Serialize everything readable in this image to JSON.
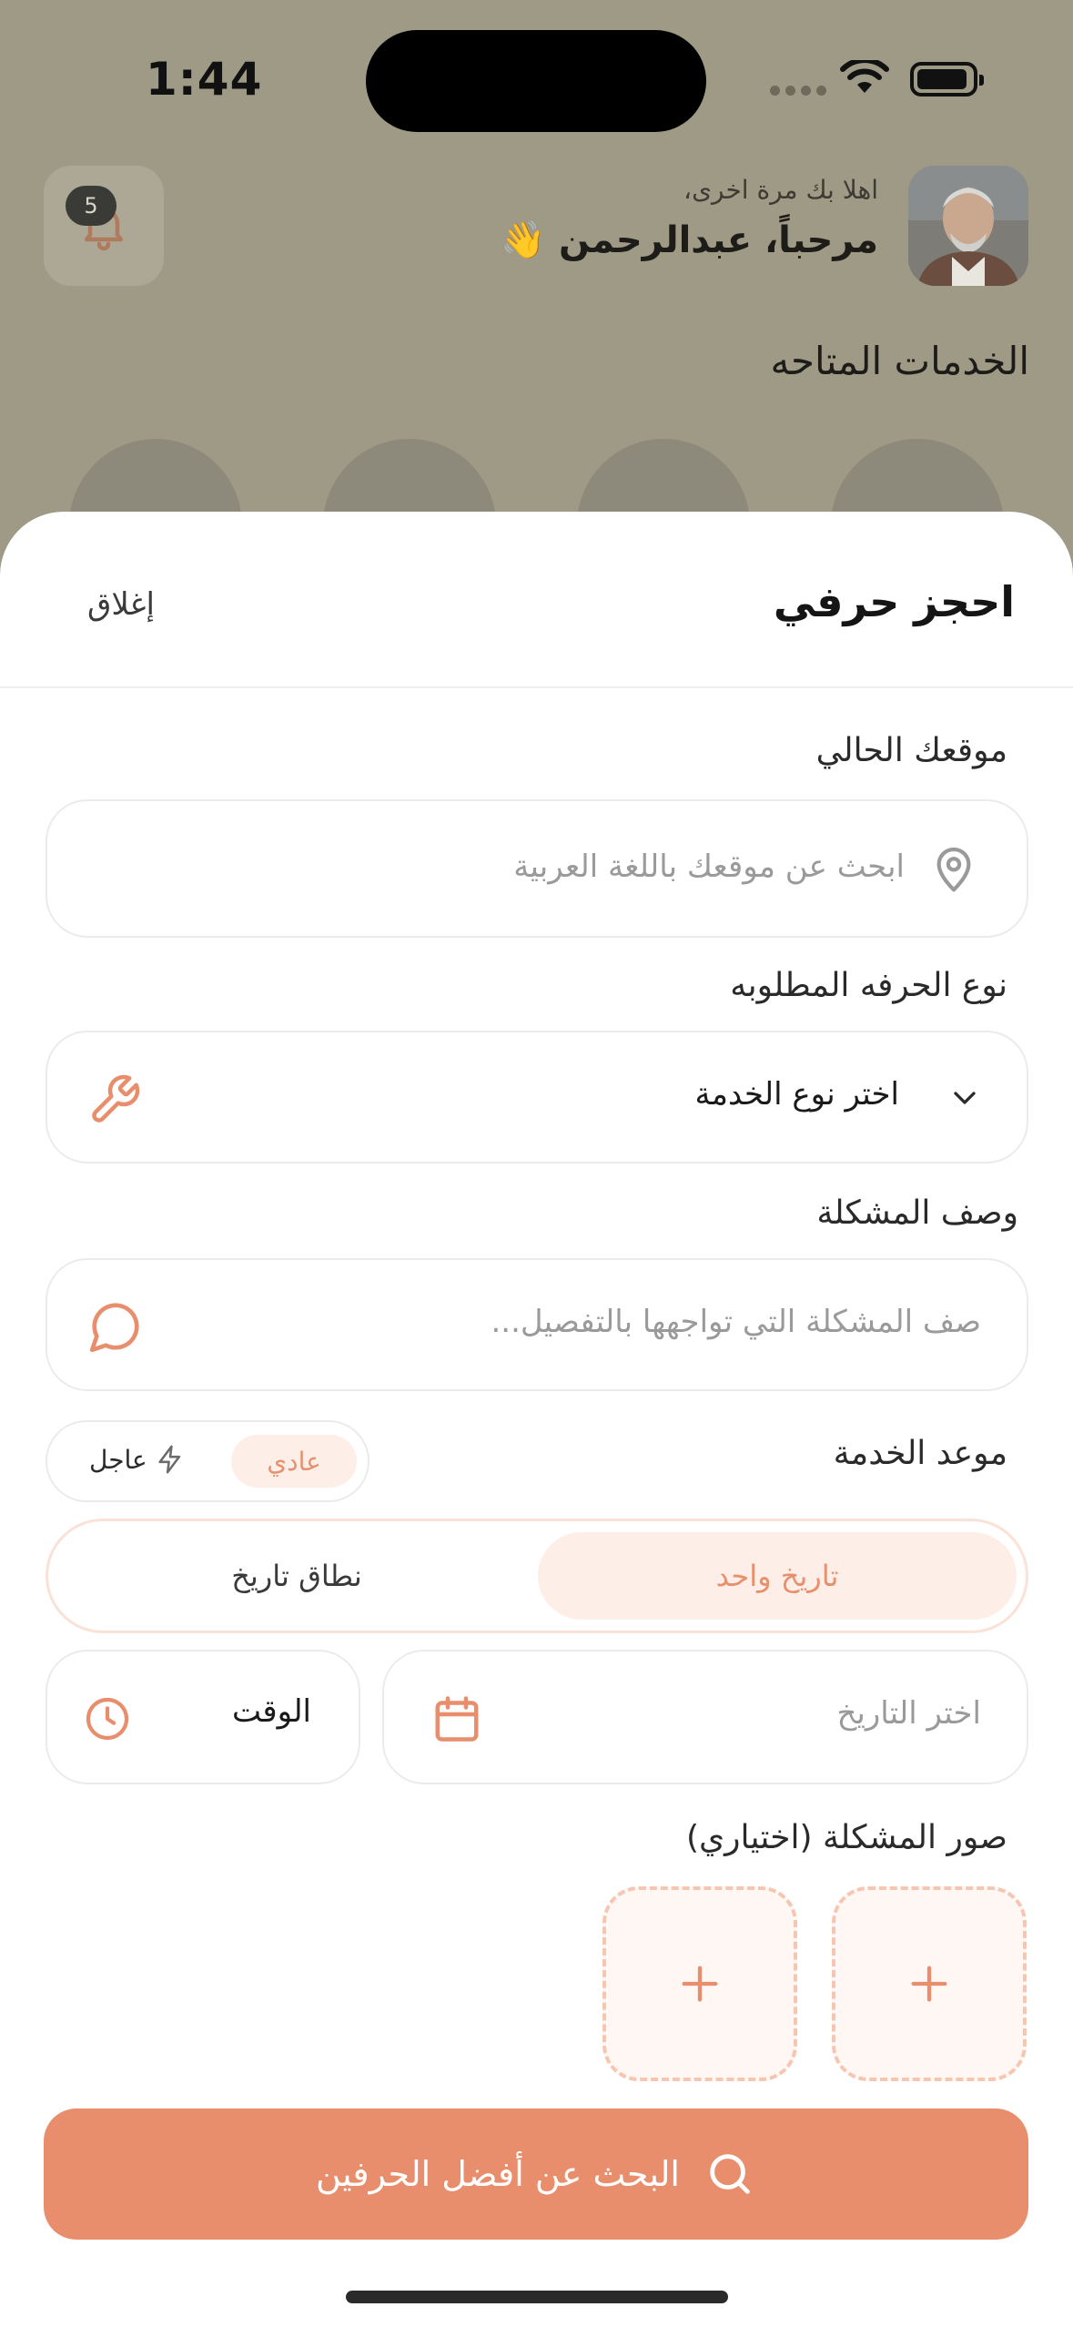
{
  "status_bar": {
    "time": "1:44"
  },
  "header": {
    "greeting_sub": "اهلا بك مرة اخرى،",
    "greeting_main": "مرحباً، عبدالرحمن 👋",
    "notification_count": "5"
  },
  "home": {
    "services_title": "الخدمات المتاحه"
  },
  "sheet": {
    "title": "احجز حرفي",
    "close_label": "إغلاق",
    "location": {
      "label": "موقعك الحالي",
      "placeholder": "ابحث عن موقعك باللغة العربية"
    },
    "craft_type": {
      "label": "نوع الحرفه المطلوبه",
      "value": "اختر نوع الخدمة"
    },
    "problem_description": {
      "label": "وصف المشكلة",
      "placeholder": "صف المشكلة التي تواجهها بالتفصيل..."
    },
    "service_schedule": {
      "label": "موعد الخدمة",
      "urgency_normal": "عادي",
      "urgency_urgent": "عاجل",
      "mode_single": "تاريخ واحد",
      "mode_range": "نطاق تاريخ",
      "date_placeholder": "اختر التاريخ",
      "time_label": "الوقت"
    },
    "photos": {
      "label": "صور المشكلة (اختياري)",
      "add_symbol": "+"
    },
    "search_button": "البحث عن أفضل الحرفين"
  },
  "colors": {
    "accent": "#e98e6d",
    "accent_light": "#fdeee7",
    "dashed_border": "#f6c6b1",
    "overlay_background": "#9e9a86"
  }
}
